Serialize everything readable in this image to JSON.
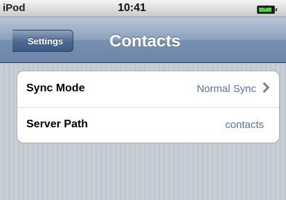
{
  "status_bar": {
    "carrier": "iPod",
    "time": "10:41"
  },
  "nav_bar": {
    "back_label": "Settings",
    "title": "Contacts"
  },
  "settings": {
    "rows": [
      {
        "label": "Sync Mode",
        "value": "Normal Sync"
      },
      {
        "label": "Server Path",
        "value": "contacts"
      }
    ]
  },
  "colors": {
    "nav_bar": "#7890b0",
    "value_text": "#5773a0",
    "battery_charge": "#4ed33c",
    "background": "#c5ccd4"
  },
  "icons": [
    "battery-charging-icon",
    "chevron-right-icon"
  ]
}
